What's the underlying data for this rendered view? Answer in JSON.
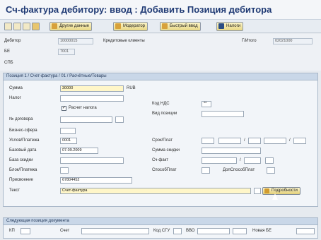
{
  "window": {
    "title": "Сч-фактура дебитору: ввод : Добавить Позиция дебитора"
  },
  "toolbar": {
    "buttons": [
      {
        "label": "Другие данные"
      },
      {
        "label": "Модератор"
      },
      {
        "label": "Быстрый ввод"
      },
      {
        "label": "Налоги"
      }
    ]
  },
  "header": {
    "debitor_label": "Дебитор",
    "debitor_value": "10000015",
    "customer_ref_label": "Кредитовые клиенты",
    "be_label": "БЕ",
    "be_value": "7001",
    "spb_label": "СПБ",
    "total_label": "Г/Итого",
    "total_value": "02021000"
  },
  "position_section": {
    "title": "Позиция 1 / Счет-фактура / 01 / Расчётные/Товары",
    "sum_label": "Сумма",
    "sum_value": "30000",
    "currency": "RUB",
    "tax_label": "Налог",
    "calc_tax_label": "Расчет налога",
    "tax_code_label": "Код НДС",
    "tax_code_value": "**",
    "contract_label": "№ договора",
    "pos_type_label": "Вид позиции",
    "business_area_label": "Бизнес-сфера",
    "payment_terms_label": "Услов/Платежа",
    "payment_terms_value": "0001",
    "due_date_label": "Срок/Плат",
    "baseline_date_label": "Базовый дата",
    "baseline_date_value": "07.09.2009",
    "discount_sum_label": "Сумма скидки",
    "base_discount_label": "База скидки",
    "invoice_label": "Сч-факт",
    "block_payment_label": "Блок/Платежа",
    "payment_method_label": "СпособПлат",
    "add_payment_label": "ДопСпособПлат",
    "assignment_label": "Присвоение",
    "assignment_value": "67804452",
    "text_label": "Текст",
    "text_value": "Счет-фактура",
    "details_button": "Подробности"
  },
  "next_section": {
    "title": "Следующая позиция документа",
    "kp_label": "КП",
    "account_label": "Счет",
    "code_label": "Код СГУ",
    "vvo_label": "ВВО",
    "new_be_label": "Новая БЕ"
  }
}
